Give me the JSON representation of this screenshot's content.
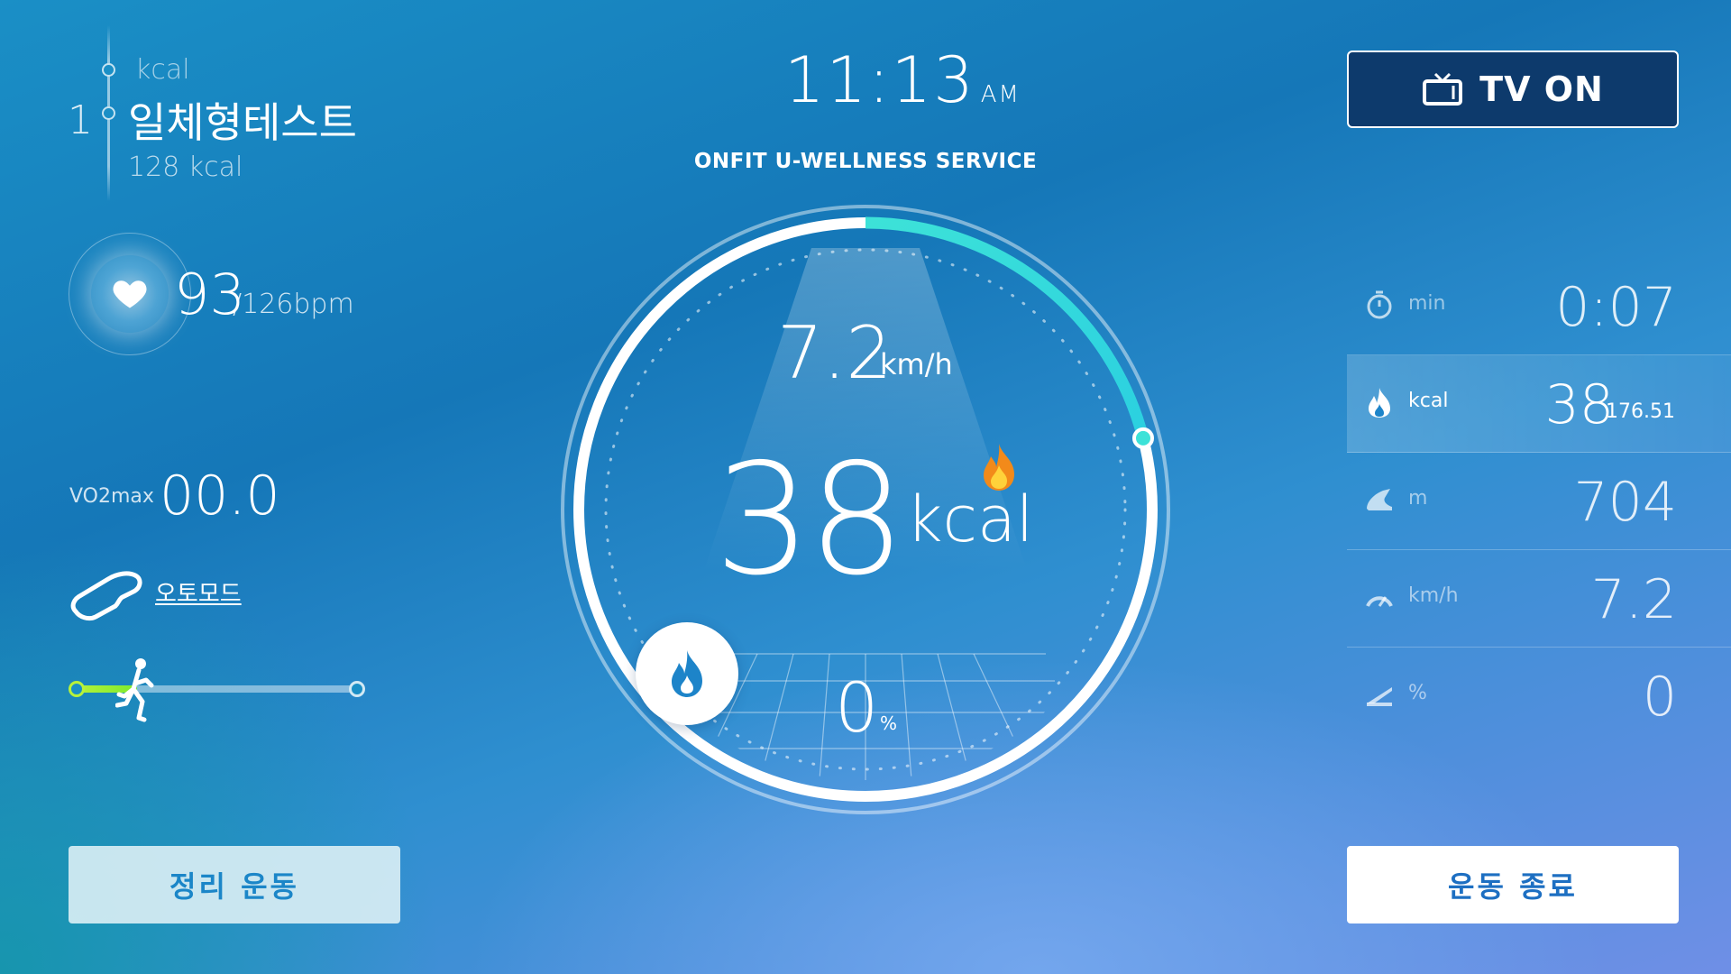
{
  "program": {
    "top_label": "kcal",
    "index": "1",
    "title": "일체형테스트",
    "kcal": "128 kcal"
  },
  "heart": {
    "bpm": "93",
    "max": "/126bpm"
  },
  "vo2": {
    "label": "VO2max",
    "value": "00.0"
  },
  "mode": {
    "label": "오토모드"
  },
  "workout_progress": 0.22,
  "clock": {
    "time": "11:13",
    "ampm": "AM"
  },
  "brand": "ONFIT U-WELLNESS SERVICE",
  "gauge": {
    "speed": "7.2",
    "speed_unit": "km/h",
    "kcal": "38",
    "kcal_unit": "kcal",
    "incline": "0",
    "incline_unit": "%",
    "progress": 0.21
  },
  "tv": {
    "label": "TV ON"
  },
  "stats": [
    {
      "icon": "stopwatch-icon",
      "unit": "min",
      "value": "0:07",
      "sub": ""
    },
    {
      "icon": "flame-icon",
      "unit": "kcal",
      "value": "38",
      "sub": "176.51"
    },
    {
      "icon": "shoe-icon",
      "unit": "m",
      "value": "704",
      "sub": ""
    },
    {
      "icon": "speedometer-icon",
      "unit": "km/h",
      "value": "7.2",
      "sub": ""
    },
    {
      "icon": "incline-icon",
      "unit": "%",
      "value": "0",
      "sub": ""
    }
  ],
  "buttons": {
    "cooldown": "정리 운동",
    "end": "운동 종료"
  },
  "colors": {
    "accent": "#3de2d8",
    "progress_green": "#b7f23a",
    "tv_button_bg": "#0d3a6c"
  }
}
